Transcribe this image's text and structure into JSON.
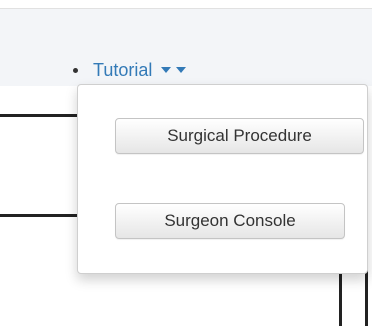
{
  "nav": {
    "tutorial_label": "Tutorial"
  },
  "dropdown": {
    "items": [
      {
        "label": "Surgical Procedure"
      },
      {
        "label": "Surgeon Console"
      }
    ]
  },
  "colors": {
    "link": "#337ab7",
    "navbar_bg": "#f3f5f8",
    "text": "#333333"
  },
  "icons": {
    "caret_1": "caret-down-icon",
    "caret_2": "caret-down-icon"
  }
}
